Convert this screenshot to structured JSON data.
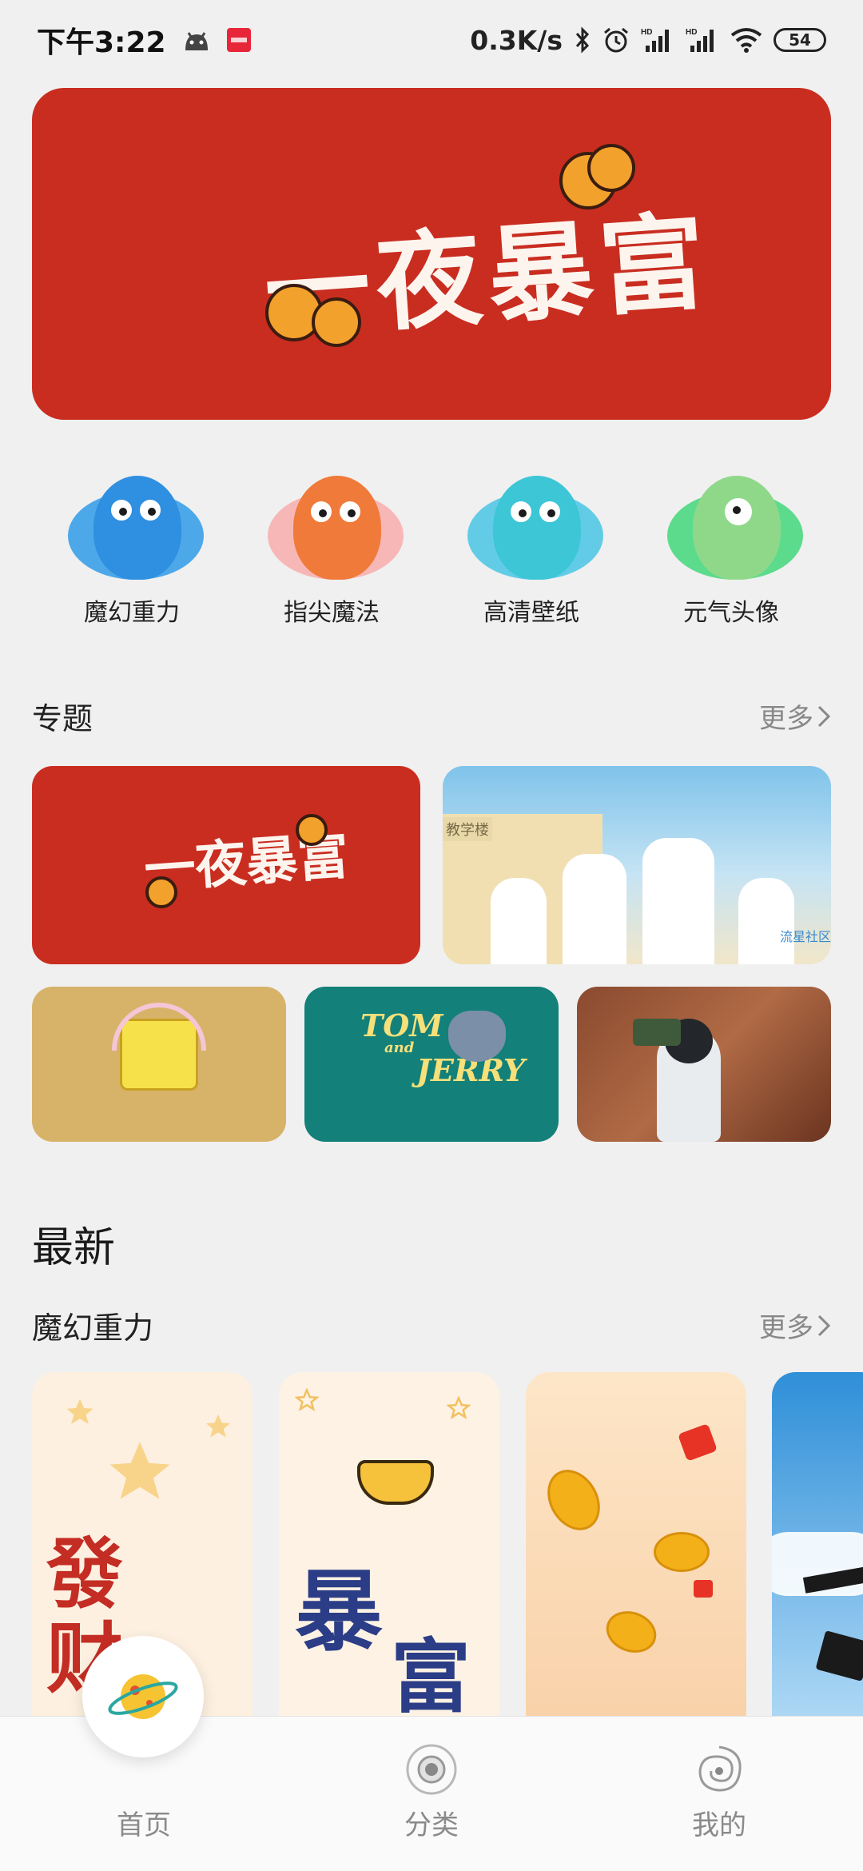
{
  "status_bar": {
    "time": "下午3:22",
    "network_speed": "0.3K/s",
    "battery": "54",
    "icons": [
      "android-icon",
      "app-notification-icon",
      "bluetooth-icon",
      "alarm-icon",
      "hd-signal-icon",
      "hd-signal-icon",
      "wifi-icon",
      "battery-icon"
    ]
  },
  "banner": {
    "title": "一夜暴富"
  },
  "categories": [
    {
      "label": "魔幻重力",
      "color": "#2f8fe0",
      "blob": "#3aa0e8"
    },
    {
      "label": "指尖魔法",
      "color": "#f07a3a",
      "blob": "#f8b0b0"
    },
    {
      "label": "高清壁纸",
      "color": "#3cc6d6",
      "blob": "#52c8e6"
    },
    {
      "label": "元气头像",
      "color": "#8fd88a",
      "blob": "#4cd882"
    }
  ],
  "topics_section": {
    "title": "专题",
    "more": "更多"
  },
  "topics": {
    "card1_title": "一夜暴富",
    "card2_sign": "教学楼",
    "card2_watermark": "流星社区",
    "card4_title_tom": "TOM",
    "card4_title_and": "and",
    "card4_title_jerry": "JERRY"
  },
  "latest": {
    "title": "最新"
  },
  "wallpaper_section": {
    "title": "魔幻重力",
    "more": "更多"
  },
  "wallpapers": {
    "w1_text": "發 财",
    "w2_text_1": "暴",
    "w2_text_2": "富"
  },
  "bottom_nav": [
    {
      "label": "首页",
      "icon": "planet-icon",
      "active": true
    },
    {
      "label": "分类",
      "icon": "orbit-icon",
      "active": false
    },
    {
      "label": "我的",
      "icon": "galaxy-icon",
      "active": false
    }
  ]
}
